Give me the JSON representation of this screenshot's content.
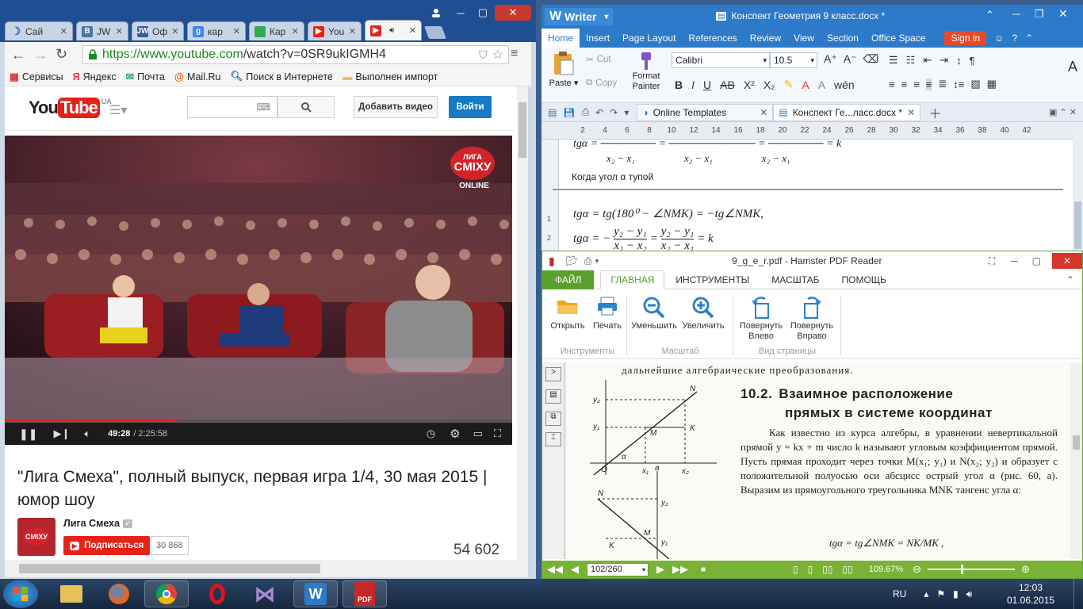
{
  "chrome": {
    "tabs": [
      {
        "label": "Сай",
        "icon": "moon-icon",
        "color": "#2a6ac1"
      },
      {
        "label": "JW",
        "icon": "vk-icon",
        "color": "#4a76a8"
      },
      {
        "label": "Оф",
        "icon": "jw-icon",
        "color": "#3b5b9a"
      },
      {
        "label": "кар",
        "icon": "google-icon",
        "color": "#4285f4"
      },
      {
        "label": "Кар",
        "icon": "maps-icon",
        "color": "#34a853"
      },
      {
        "label": "You",
        "icon": "youtube-icon",
        "color": "#e62117"
      },
      {
        "label": "",
        "icon": "youtube-icon",
        "color": "#e62117"
      }
    ],
    "url_host": "https://www.youtube.com",
    "url_path": "/watch?v=0SR9ukIGMH4",
    "bookmarks": [
      {
        "label": "Сервисы",
        "icon": "apps-icon"
      },
      {
        "label": "Яндекс",
        "icon": "yandex-icon"
      },
      {
        "label": "Почта",
        "icon": "mail-icon"
      },
      {
        "label": "Mail.Ru",
        "icon": "mailru-icon"
      },
      {
        "label": "Поиск в Интернете",
        "icon": "search-icon"
      },
      {
        "label": "Выполнен импорт",
        "icon": "folder-icon"
      }
    ]
  },
  "youtube": {
    "logo": "YouTube",
    "region": "UA",
    "add_video": "Добавить видео",
    "login": "Войти",
    "overlay_logo_line1": "ЛИГА",
    "overlay_logo_line2": "СМІХУ",
    "overlay_online": "ONLINE",
    "time_current": "49:28",
    "time_total": "/ 2:25:58",
    "progress": 0.339,
    "title": "\"Лига Смеха\", полный выпуск, первая игра 1/4, 30 мая 2015 | юмор шоу",
    "channel": "Лига Смеха",
    "subscribe": "Подписаться",
    "subscribers": "30 868",
    "views": "54 602"
  },
  "writer": {
    "app": "Writer",
    "doc_title": "Конспект Геометрия 9 класс.docx *",
    "menu": [
      "Home",
      "Insert",
      "Page Layout",
      "References",
      "Review",
      "View",
      "Section",
      "Office Space"
    ],
    "signin": "Sign in",
    "font_name": "Calibri",
    "font_size": "10.5",
    "paste": "Paste",
    "cut": "Cut",
    "copy": "Copy",
    "format_painter": "Format Painter",
    "doc_tabs": [
      "Online Templates",
      "Конспект Ге...ласс.docx *"
    ],
    "ruler": [
      "2",
      "4",
      "6",
      "8",
      "10",
      "12",
      "14",
      "16",
      "18",
      "20",
      "22",
      "24",
      "26",
      "28",
      "30",
      "32",
      "34",
      "36",
      "38",
      "40",
      "42"
    ],
    "line_top": "tgα = ─────── = ─────────── = ─────── = k",
    "line_denoms": [
      "x₂ − x₁",
      "x₂ − x₁",
      "x₂ − x₁"
    ],
    "obtuse": "Когда угол α тупой",
    "eq1": "tgα = tg(180⁰ − ∠NMK) = −tg∠NMK,",
    "eq2_lhs": "tgα = −",
    "eq2_frac1_num": "y₂ − y₁",
    "eq2_frac1_den": "x₁ − x₂",
    "eq2_frac2_num": "y₂ − y₁",
    "eq2_frac2_den": "x₂ − x₁",
    "eq2_rhs": "= k"
  },
  "hamster": {
    "title": "9_g_e_r.pdf - Hamster PDF Reader",
    "tabs": [
      "ФАЙЛ",
      "ГЛАВНАЯ",
      "ИНСТРУМЕНТЫ",
      "МАСШТАБ",
      "ПОМОЩЬ"
    ],
    "buttons": [
      {
        "label": "Открыть",
        "icon": "folder-open-icon"
      },
      {
        "label": "Печать",
        "icon": "printer-icon"
      },
      {
        "label": "Уменьшить",
        "icon": "zoom-out-icon"
      },
      {
        "label": "Увеличить",
        "icon": "zoom-in-icon"
      },
      {
        "label": "Повернуть Влево",
        "icon": "rotate-left-icon"
      },
      {
        "label": "Повернуть Вправо",
        "icon": "rotate-right-icon"
      }
    ],
    "groups": [
      "Инструменты",
      "Масштаб",
      "Вид страницы"
    ],
    "page_text_top": "дальнейшие алгебраические преобразования.",
    "section_num": "10.2.",
    "section_title_1": "Взаимное расположение",
    "section_title_2": "прямых в системе координат",
    "paragraph": "Как известно из курса алгебры, в уравнении невертикальной прямой y = kx + m число k называют угловым коэффициентом прямой. Пусть прямая проходит через точки M(x₁; y₁) и N(x₂; y₂) и образует с положительной полуосью оси абсцисс острый угол α (рис. 60, a). Выразим из прямоугольного треугольника MNK тангенс угла α:",
    "formula": "tgα = tg∠NMK = NK/MK ,",
    "page": "102/260",
    "zoom": "109.67%"
  },
  "taskbar": {
    "lang": "RU",
    "time": "12:03",
    "date": "01.06.2015"
  }
}
